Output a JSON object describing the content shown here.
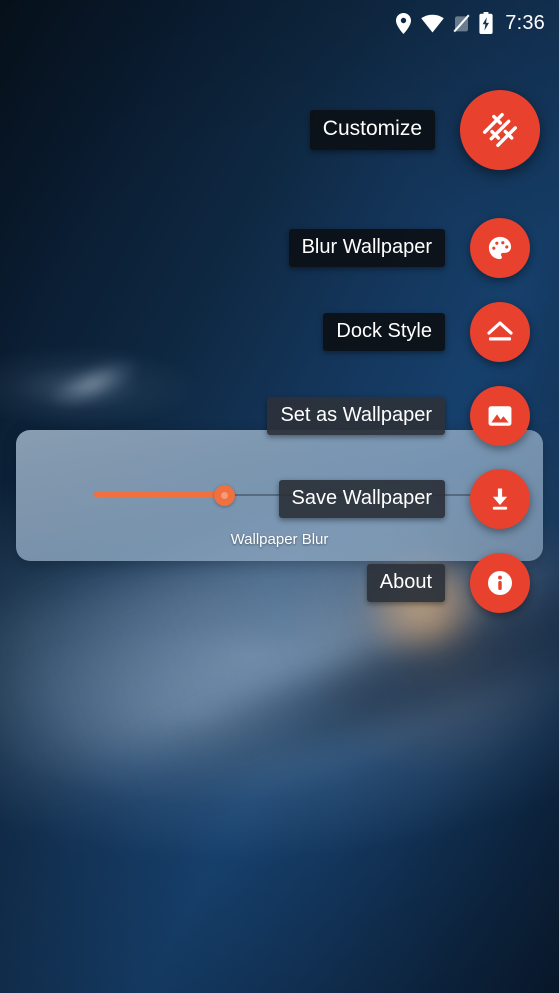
{
  "status_bar": {
    "icons": [
      "location-pin-icon",
      "wifi-icon",
      "signal-off-icon",
      "battery-charging-icon"
    ],
    "time": "7:36"
  },
  "fab_menu": {
    "accent_color": "#E8422F",
    "items": [
      {
        "label": "Customize",
        "icon": "tune-sliders-icon",
        "size": "large"
      },
      {
        "label": "Blur Wallpaper",
        "icon": "palette-icon",
        "size": "mini"
      },
      {
        "label": "Dock Style",
        "icon": "chevron-up-bar-icon",
        "size": "mini"
      },
      {
        "label": "Set as Wallpaper",
        "icon": "image-icon",
        "size": "mini"
      },
      {
        "label": "Save Wallpaper",
        "icon": "download-icon",
        "size": "mini"
      },
      {
        "label": "About",
        "icon": "info-icon",
        "size": "mini"
      }
    ]
  },
  "blur_card": {
    "label": "Wallpaper Blur",
    "slider": {
      "name": "wallpaper-blur-slider",
      "value_percent": 31,
      "fill_color": "#F1703F",
      "track_color": "#3A4858"
    }
  }
}
